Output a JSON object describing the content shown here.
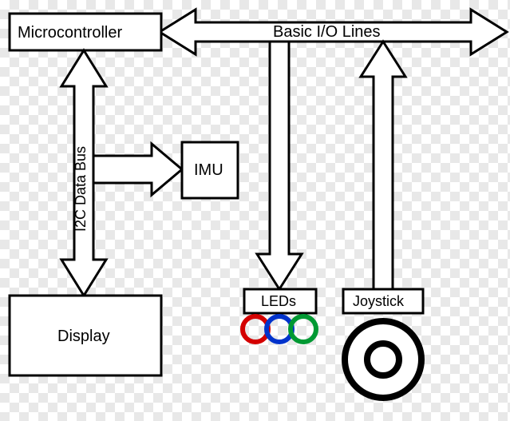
{
  "nodes": {
    "microcontroller": "Microcontroller",
    "imu": "IMU",
    "display": "Display",
    "leds": "LEDs",
    "joystick": "Joystick"
  },
  "edges": {
    "io_lines": "Basic I/O Lines",
    "i2c_bus": "I2C Data Bus"
  },
  "led_colors": [
    "#d40000",
    "#0033cc",
    "#009933"
  ]
}
